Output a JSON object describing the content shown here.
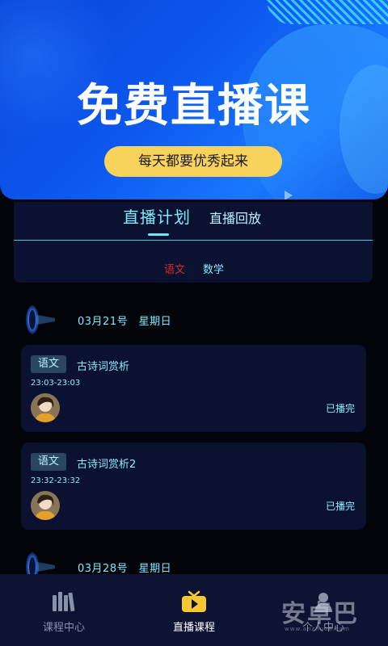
{
  "hero": {
    "title": "免费直播课",
    "slogan": "每天都要优秀起来"
  },
  "tabs": {
    "live_plan": "直播计划",
    "replay": "直播回放",
    "subjects": [
      "语文",
      "数学"
    ],
    "active_subject_color": "#e0282d"
  },
  "schedule": [
    {
      "date": "03月21号　星期日",
      "courses": [
        {
          "subject": "语文",
          "title": "古诗词赏析",
          "time": "23:03-23:03",
          "status": "已播完"
        },
        {
          "subject": "语文",
          "title": "古诗词赏析2",
          "time": "23:32-23:32",
          "status": "已播完"
        }
      ]
    },
    {
      "date": "03月28号　星期日",
      "courses": []
    }
  ],
  "bottom_nav": {
    "courses": "课程中心",
    "live": "直播课程",
    "me": "个人中心"
  },
  "watermark": {
    "text": "安卓巴",
    "sub": "www.anzhuo8.com"
  },
  "colors": {
    "accent_cyan": "#7eeaff",
    "hero_blue": "#0d58ee",
    "slogan_yellow": "#f8d35c",
    "card_bg": "#0b1130",
    "nav_live_icon": "#f6c931"
  }
}
